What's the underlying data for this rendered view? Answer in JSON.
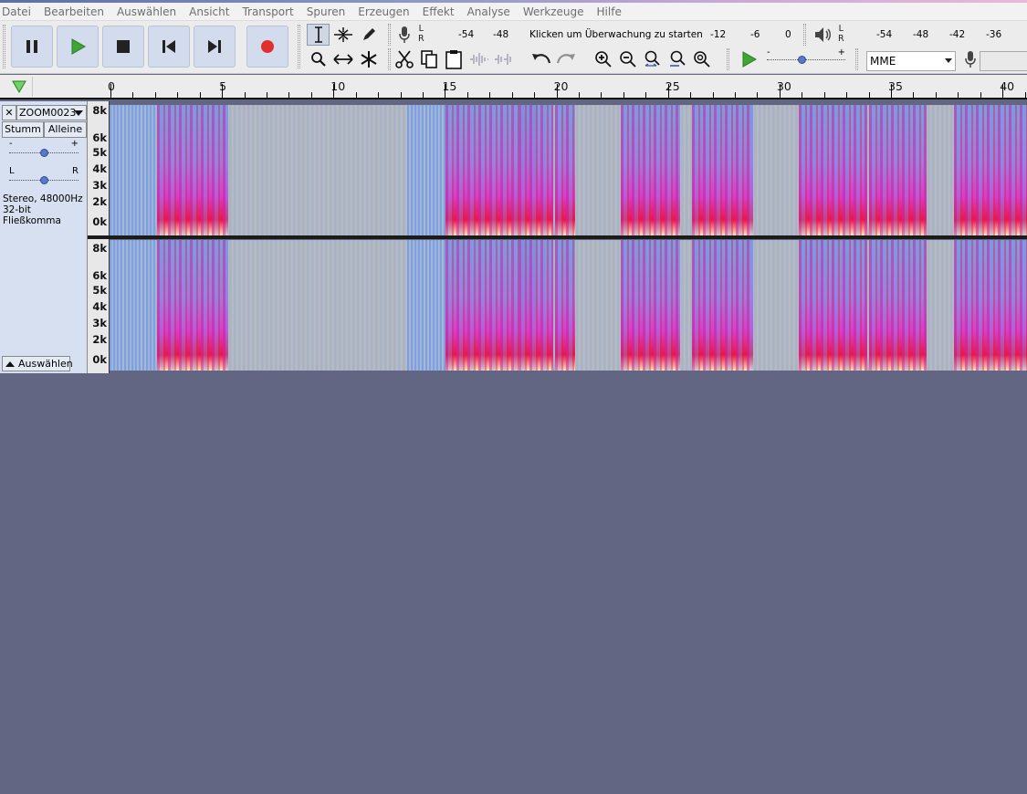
{
  "menu": [
    "Datei",
    "Bearbeiten",
    "Auswählen",
    "Ansicht",
    "Transport",
    "Spuren",
    "Erzeugen",
    "Effekt",
    "Analyse",
    "Werkzeuge",
    "Hilfe"
  ],
  "transport": {
    "pause_icon": "pause-icon",
    "play_icon": "play-icon",
    "stop_icon": "stop-icon",
    "skip_start_icon": "skip-to-start-icon",
    "skip_end_icon": "skip-to-end-icon",
    "record_icon": "record-icon"
  },
  "recording_meter": {
    "l": "L",
    "r": "R",
    "ticks": [
      "-54",
      "-48",
      "-12",
      "-6",
      "0"
    ],
    "hint": "Klicken um Überwachung zu starten"
  },
  "playback_meter": {
    "l": "L",
    "r": "R",
    "ticks": [
      "-54",
      "-48",
      "-42",
      "-36"
    ]
  },
  "playspeed": {
    "minus": "-",
    "plus": "+",
    "level": 0.45
  },
  "host_select": "MME",
  "ruler": {
    "labels": [
      "0",
      "5",
      "10",
      "15",
      "20",
      "25",
      "30",
      "35",
      "40"
    ]
  },
  "track": {
    "name": "ZOOM0023",
    "close": "✕",
    "mute": "Stumm",
    "solo": "Alleine",
    "gain_minus": "-",
    "gain_plus": "+",
    "pan_l": "L",
    "pan_r": "R",
    "info_line1": "Stereo, 48000Hz",
    "info_line2": "32-bit Fließkomma",
    "select_button": "Auswählen",
    "gain_level": 0.5,
    "pan_level": 0.5
  },
  "freq_scale": [
    "8k",
    "6k",
    "5k",
    "4k",
    "3k",
    "2k",
    "0k"
  ],
  "colors": {
    "spectrogram_bg": "#bcbcbc",
    "spectrogram_blue": "#6f9be8",
    "spectrogram_magenta": "#d43fd0",
    "spectrogram_red": "#e8174e",
    "track_panel": "#d6e0f0",
    "background": "#636683",
    "record": "#e0302e",
    "play": "#3fa535"
  }
}
